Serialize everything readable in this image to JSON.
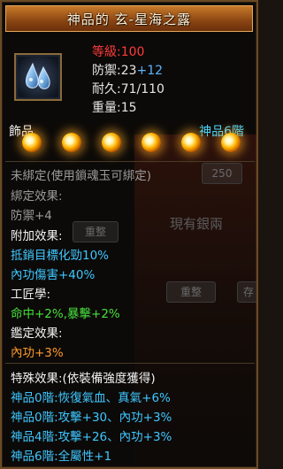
{
  "title": "神品的 玄-星海之露",
  "stats": {
    "level": "等級:100",
    "defense_base": "防禦:23",
    "defense_bonus": "+12",
    "durability": "耐久:71/110",
    "weight": "重量:15"
  },
  "category": "飾品",
  "tier": "神品6階",
  "bind_status": "未綁定(使用鎖魂玉可綁定)",
  "bind_effect": {
    "header": "綁定效果:",
    "lines": [
      "防禦+4"
    ]
  },
  "extra_effect": {
    "header": "附加效果:",
    "lines": [
      "抵銷目標化勁10%",
      "內功傷害+40%"
    ]
  },
  "craft": {
    "header": "工匠學:",
    "lines": [
      "命中+2%,暴擊+2%"
    ]
  },
  "appraise": {
    "header": "鑑定效果:",
    "lines": [
      "內功+3%"
    ]
  },
  "special": {
    "header": "特殊效果:(依裝備強度獲得)",
    "lines": [
      "神品0階:恢復氣血、真氣+6%",
      "神品0階:攻擊+30、內功+3%",
      "神品4階:攻擊+26、內功+3%",
      "神品6階:全屬性+1"
    ]
  },
  "background": {
    "slot_count": "250",
    "silver_label": "現有銀兩",
    "button_reorganize_1": "重整",
    "button_reorganize_2": "重整",
    "button_store": "存"
  },
  "icon": {
    "name": "dewdrop-icon"
  },
  "colors": {
    "title_bg": "#8a4412",
    "level": "#ff3b3b",
    "bonus": "#5ab4ff",
    "tier": "#4ad8ff",
    "cyan_text": "#3ec7ff",
    "green_text": "#46e03c",
    "orange_text": "#ff9a2a",
    "grey_text": "#9a9a9a"
  }
}
